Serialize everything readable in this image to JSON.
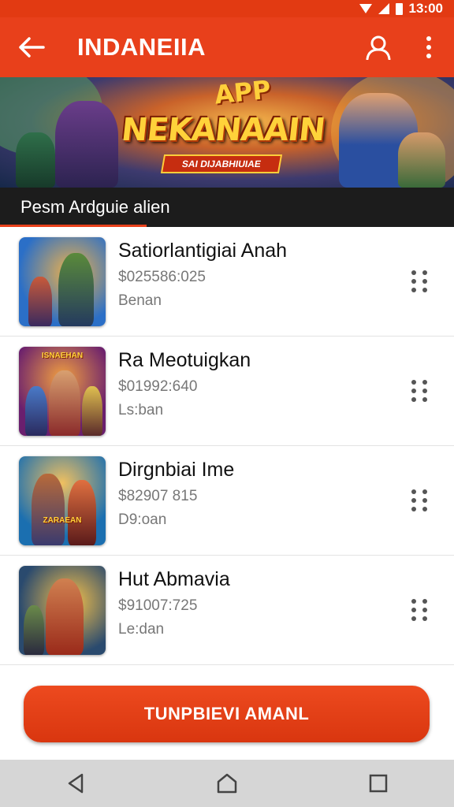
{
  "status_bar": {
    "time": "13:00"
  },
  "app_bar": {
    "title": "INDANEIIA"
  },
  "banner": {
    "badge": "APP",
    "title": "NEKANAAIN",
    "subtitle": "SAI DIJABHIUIAE"
  },
  "caption": {
    "text": "Pesm Ardguie alien"
  },
  "items": [
    {
      "title": "Satiorlantigiai Anah",
      "price": "$025586:025",
      "sub": "Benan",
      "thumb_label": "",
      "thumb_colors": [
        "#2b6fc7",
        "#e8a13a"
      ]
    },
    {
      "title": "Ra Meotuigkan",
      "price": "$01992:640",
      "sub": "Ls:ban",
      "thumb_label": "ISNAEHAN",
      "thumb_colors": [
        "#6a1f6e",
        "#d9402a"
      ]
    },
    {
      "title": "Dirgnbiai Ime",
      "price": "$82907 815",
      "sub": "D9:oan",
      "thumb_label": "ZARAEAN",
      "thumb_colors": [
        "#1b6fb0",
        "#e0572a"
      ]
    },
    {
      "title": "Hut Abmavia",
      "price": "$91007:725",
      "sub": "Le:dan",
      "thumb_label": "",
      "thumb_colors": [
        "#2a4a6e",
        "#e0a23a"
      ]
    }
  ],
  "cta": {
    "label": "TUNPBIEVI AMANL"
  },
  "colors": {
    "accent": "#e8401b",
    "caption_bg": "#1c1c1c",
    "nav_bg": "#d6d6d6"
  }
}
